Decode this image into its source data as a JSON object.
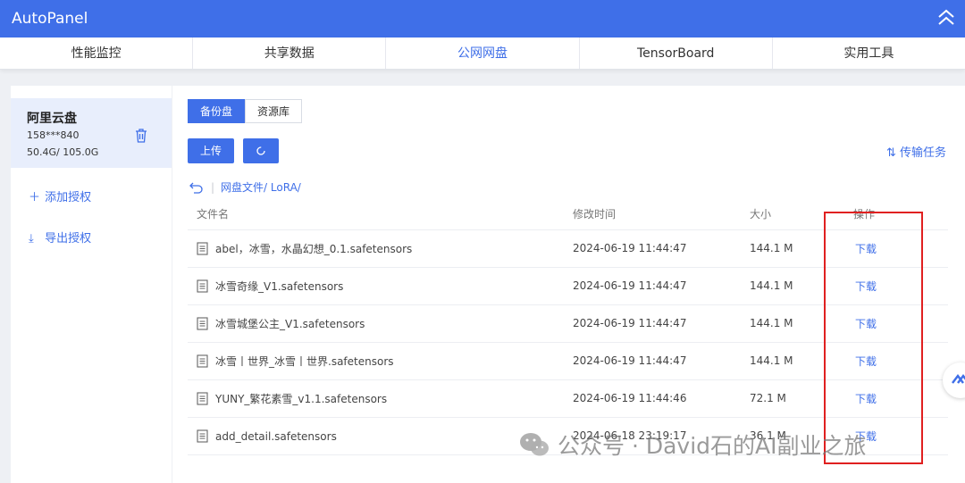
{
  "app": {
    "title": "AutoPanel"
  },
  "tabs": [
    {
      "label": "性能监控"
    },
    {
      "label": "共享数据"
    },
    {
      "label": "公网网盘"
    },
    {
      "label": "TensorBoard"
    },
    {
      "label": "实用工具"
    }
  ],
  "sidebar": {
    "account": {
      "name": "阿里云盘",
      "phone": "158***840",
      "quota": "50.4G/ 105.0G"
    },
    "add_auth": "添加授权",
    "export_auth": "导出授权"
  },
  "main": {
    "segments": [
      "备份盘",
      "资源库"
    ],
    "upload_label": "上传",
    "transfer_label": "传输任务",
    "breadcrumb": "网盘文件/ LoRA/",
    "columns": {
      "name": "文件名",
      "time": "修改时间",
      "size": "大小",
      "action": "操作"
    },
    "files": [
      {
        "name": "abel，冰雪，水晶幻想_0.1.safetensors",
        "time": "2024-06-19 11:44:47",
        "size": "144.1 M",
        "action": "下载"
      },
      {
        "name": "冰雪奇缘_V1.safetensors",
        "time": "2024-06-19 11:44:47",
        "size": "144.1 M",
        "action": "下载"
      },
      {
        "name": "冰雪城堡公主_V1.safetensors",
        "time": "2024-06-19 11:44:47",
        "size": "144.1 M",
        "action": "下载"
      },
      {
        "name": "冰雪丨世界_冰雪丨世界.safetensors",
        "time": "2024-06-19 11:44:47",
        "size": "144.1 M",
        "action": "下载"
      },
      {
        "name": "YUNY_繁花素雪_v1.1.safetensors",
        "time": "2024-06-19 11:44:46",
        "size": "72.1 M",
        "action": "下载"
      },
      {
        "name": "add_detail.safetensors",
        "time": "2024-06-18 23:19:17",
        "size": "36.1 M",
        "action": "下载"
      }
    ]
  },
  "watermark": "公众号 · David石的AI副业之旅",
  "colors": {
    "brand": "#3f6fe8",
    "highlight": "#e02020"
  }
}
